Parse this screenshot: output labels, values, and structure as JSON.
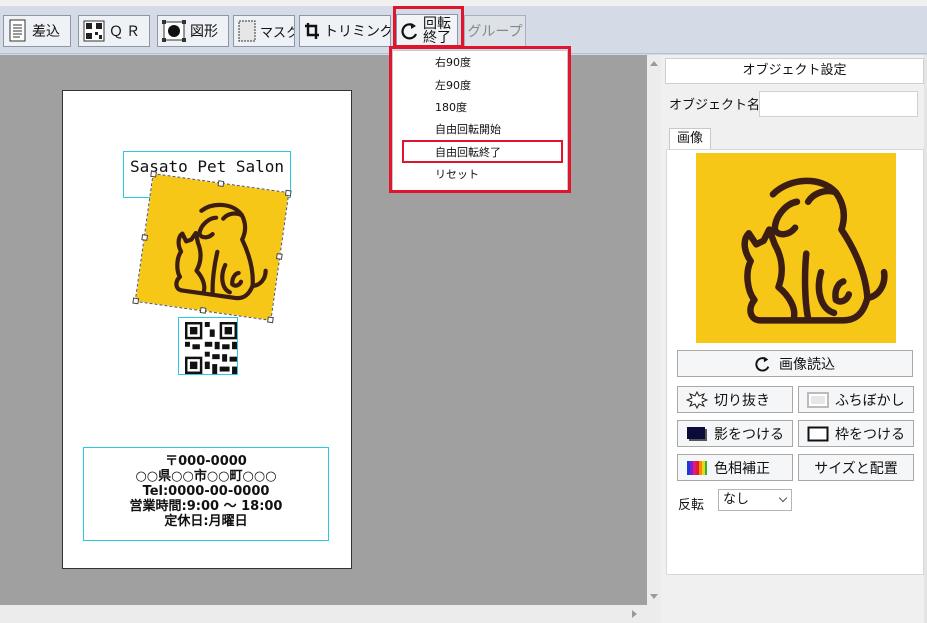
{
  "toolbar": {
    "merge_label": "差込",
    "qr_label": "ＱＲ",
    "shape_label": "図形",
    "mask_label": "マスク",
    "trim_label": "トリミング",
    "rotate_label_1": "回転",
    "rotate_label_2": "終了",
    "group_label": "グループ"
  },
  "rotate_menu": {
    "items": [
      "右90度",
      "左90度",
      "180度",
      "自由回転開始",
      "自由回転終了",
      "リセット"
    ],
    "highlighted": "自由回転終了"
  },
  "card": {
    "title": "Sasato Pet Salon",
    "address_lines": [
      "〒000-0000",
      "○○県○○市○○町○○○",
      "Tel:0000-00-0000",
      "営業時間:9:00 ～ 18:00",
      "定休日:月曜日"
    ]
  },
  "panel": {
    "title": "オブジェクト設定",
    "object_name_label": "オブジェクト名",
    "object_name_value": "",
    "tab_image": "画像",
    "load_image": "画像読込",
    "cutout": "切り抜き",
    "blur_edge": "ふちぼかし",
    "shadow": "影をつける",
    "frame": "枠をつける",
    "color_correct": "色相補正",
    "size_position": "サイズと配置",
    "flip_label": "反転",
    "flip_value": "なし"
  },
  "colors": {
    "highlight_red": "#e0142c",
    "selection_cyan": "#29c8e6",
    "logo_yellow": "#f6c716",
    "logo_brown": "#3b1d14"
  }
}
